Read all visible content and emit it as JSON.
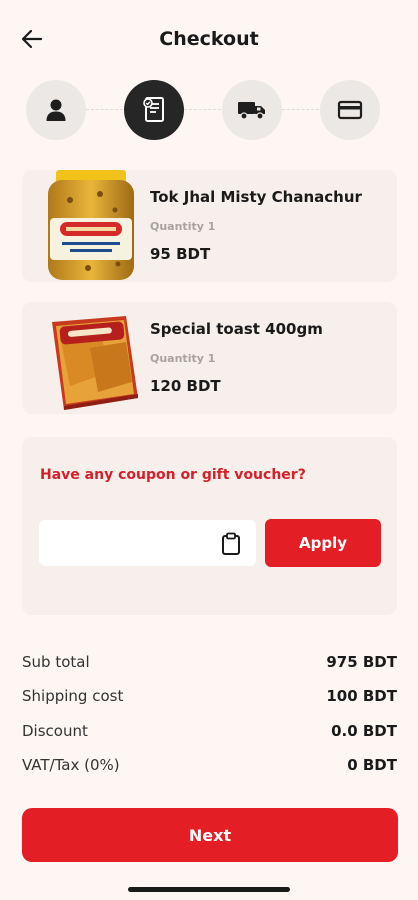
{
  "header": {
    "title": "Checkout",
    "back_icon": "arrow-left-icon"
  },
  "stepper": {
    "steps": [
      {
        "icon": "user-icon",
        "active": false
      },
      {
        "icon": "receipt-icon",
        "active": true
      },
      {
        "icon": "truck-icon",
        "active": false
      },
      {
        "icon": "card-icon",
        "active": false
      }
    ]
  },
  "cart": {
    "items": [
      {
        "name": "Tok Jhal Misty Chanachur",
        "quantity": "Quantity 1",
        "price": "95 BDT",
        "image": "chanachur-jar-image"
      },
      {
        "name": "Special toast 400gm",
        "quantity": "Quantity 1",
        "price": "120 BDT",
        "image": "toast-pack-image"
      }
    ]
  },
  "coupon": {
    "title": "Have any coupon or gift voucher?",
    "input_value": "",
    "placeholder": "",
    "apply_label": "Apply",
    "paste_icon": "clipboard-icon"
  },
  "summary": {
    "rows": [
      {
        "label": "Sub total",
        "value": "975 BDT"
      },
      {
        "label": "Shipping cost",
        "value": "100 BDT"
      },
      {
        "label": "Discount",
        "value": "0.0 BDT"
      },
      {
        "label": "VAT/Tax (0%)",
        "value": "0 BDT"
      }
    ]
  },
  "footer": {
    "next_label": "Next"
  },
  "colors": {
    "accent": "#e31e25",
    "background": "#fdf6f3",
    "card": "#f7efeb",
    "step_inactive": "#ebe8e6",
    "step_active": "#262626"
  }
}
